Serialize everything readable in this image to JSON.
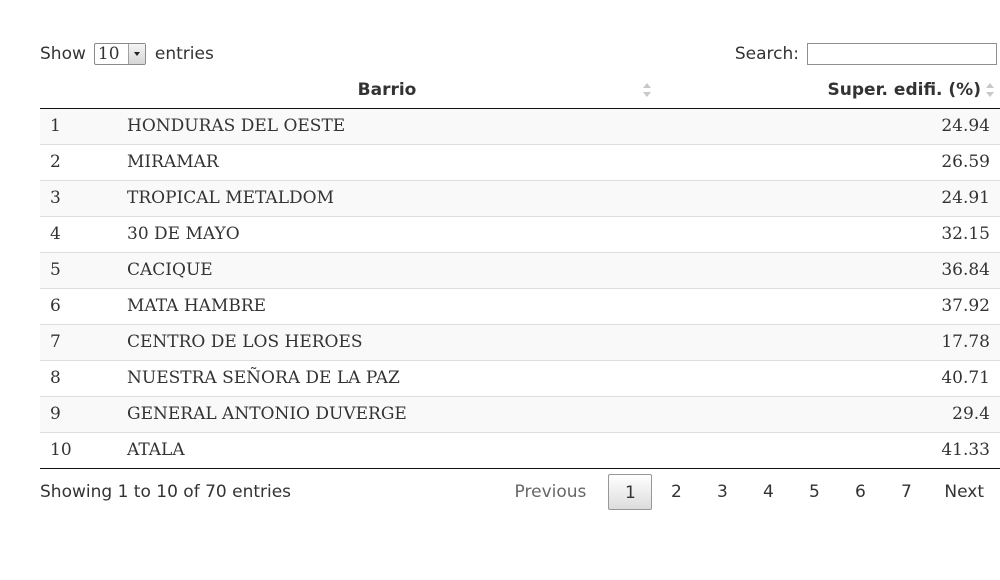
{
  "length_control": {
    "prefix": "Show",
    "selected": "10",
    "suffix": "entries"
  },
  "search": {
    "label": "Search:",
    "value": ""
  },
  "table": {
    "columns": [
      "",
      "Barrio",
      "Super. edifi. (%)"
    ],
    "rows": [
      {
        "idx": "1",
        "barrio": "HONDURAS DEL OESTE",
        "sup": "24.94"
      },
      {
        "idx": "2",
        "barrio": "MIRAMAR",
        "sup": "26.59"
      },
      {
        "idx": "3",
        "barrio": "TROPICAL METALDOM",
        "sup": "24.91"
      },
      {
        "idx": "4",
        "barrio": "30 DE MAYO",
        "sup": "32.15"
      },
      {
        "idx": "5",
        "barrio": "CACIQUE",
        "sup": "36.84"
      },
      {
        "idx": "6",
        "barrio": "MATA HAMBRE",
        "sup": "37.92"
      },
      {
        "idx": "7",
        "barrio": "CENTRO DE LOS HEROES",
        "sup": "17.78"
      },
      {
        "idx": "8",
        "barrio": "NUESTRA SEÑORA DE LA PAZ",
        "sup": "40.71"
      },
      {
        "idx": "9",
        "barrio": "GENERAL ANTONIO DUVERGE",
        "sup": "29.4"
      },
      {
        "idx": "10",
        "barrio": "ATALA",
        "sup": "41.33"
      }
    ]
  },
  "info": "Showing 1 to 10 of 70 entries",
  "pagination": {
    "previous": "Previous",
    "pages": [
      "1",
      "2",
      "3",
      "4",
      "5",
      "6",
      "7"
    ],
    "current": "1",
    "next": "Next"
  }
}
